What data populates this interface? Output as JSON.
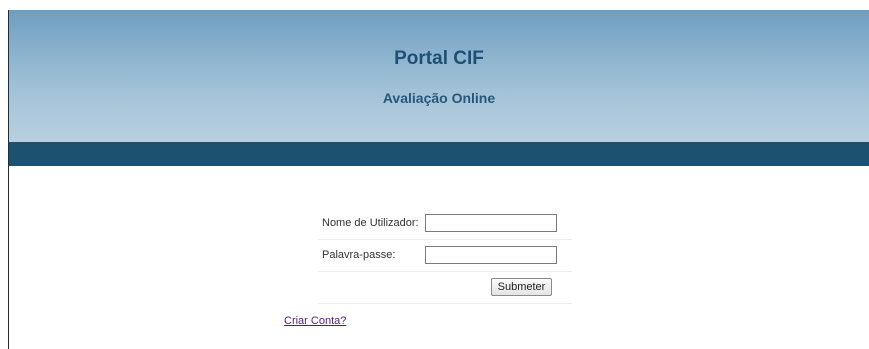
{
  "header": {
    "title": "Portal CIF",
    "subtitle": "Avaliação Online"
  },
  "login": {
    "username_label": "Nome de Utilizador:",
    "username_value": "",
    "password_label": "Palavra-passe:",
    "password_value": "",
    "submit_label": "Submeter"
  },
  "links": {
    "create_account": "Criar Conta?"
  },
  "colors": {
    "header_title": "#1f4f74",
    "band": "#1c5170",
    "link_visited": "#551a8b"
  }
}
